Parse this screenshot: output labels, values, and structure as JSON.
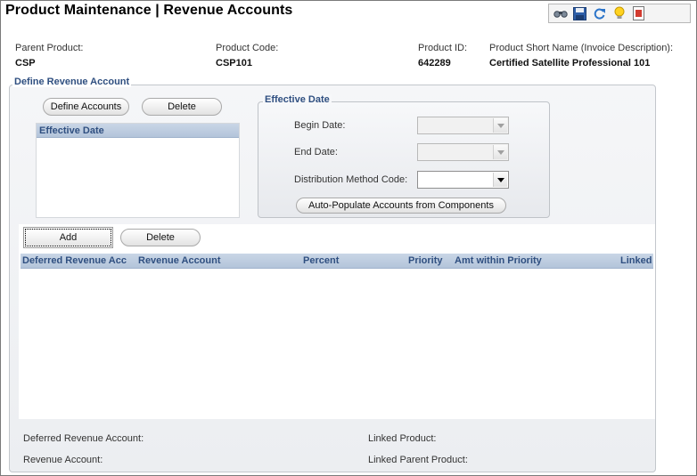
{
  "page": {
    "title": "Product Maintenance  |  Revenue Accounts"
  },
  "toolbar": {
    "icons": [
      "binoculars-icon",
      "save-icon",
      "refresh-icon",
      "lightbulb-icon",
      "report-icon"
    ]
  },
  "product": {
    "parent_product_label": "Parent Product:",
    "parent_product_value": "CSP",
    "product_code_label": "Product Code:",
    "product_code_value": "CSP101",
    "product_id_label": "Product ID:",
    "product_id_value": "642289",
    "short_name_label": "Product Short Name (Invoice Description):",
    "short_name_value": "Certified Satellite Professional 101"
  },
  "define_revenue": {
    "legend": "Define Revenue Account",
    "define_accounts_label": "Define Accounts",
    "delete_label": "Delete",
    "effective_date_list_header": "Effective Date"
  },
  "effective_date_group": {
    "legend": "Effective Date",
    "begin_date_label": "Begin Date:",
    "begin_date_value": "",
    "end_date_label": "End Date:",
    "end_date_value": "",
    "distribution_method_label": "Distribution Method Code:",
    "distribution_method_value": "",
    "auto_populate_label": "Auto-Populate Accounts from Components"
  },
  "accounts_grid": {
    "add_label": "Add",
    "delete_label": "Delete",
    "columns": [
      "Deferred Revenue Acc",
      "Revenue Account",
      "Percent",
      "Priority",
      "Amt within Priority",
      "Linked"
    ],
    "rows": []
  },
  "footer": {
    "deferred_revenue_account_label": "Deferred Revenue Account:",
    "revenue_account_label": "Revenue Account:",
    "linked_product_label": "Linked Product:",
    "linked_parent_product_label": "Linked Parent Product:"
  }
}
